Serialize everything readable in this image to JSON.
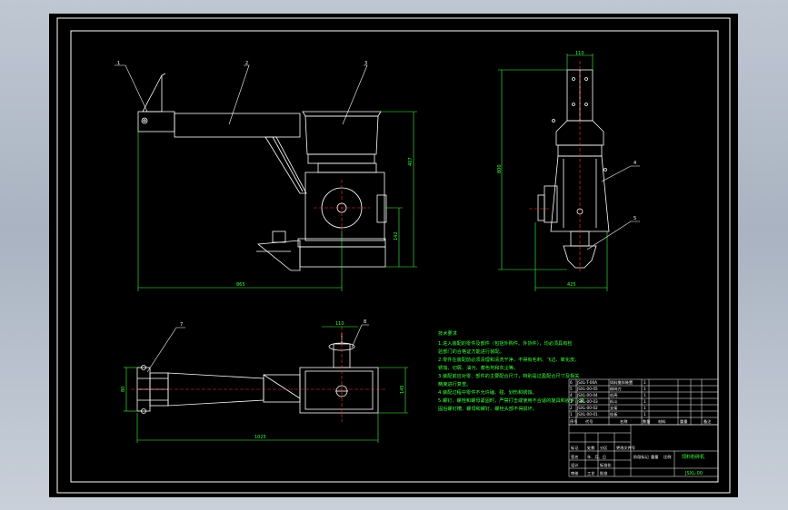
{
  "balloons": [
    "1",
    "2",
    "3",
    "4",
    "5",
    "6",
    "7",
    "8"
  ],
  "dimensions": {
    "front_overall_width": "865",
    "front_height_a": "407",
    "front_height_b": "142",
    "side_height": "800",
    "side_top_width": "110",
    "side_base_width": "425",
    "top_width": "1025",
    "top_left_h": "80",
    "top_right_h": "145",
    "top_small": "110"
  },
  "notes": {
    "heading": "技术要求",
    "lines": [
      "1.进入装配的零件及部件（包括外购件、外协件），均必须具有检",
      "验部门的合格证方能进行装配。",
      "2.零件在装配前必须清理和清洗干净，不得有毛刺、飞边、氧化皮、",
      "锈蚀、切屑、油污、着色剂和灰尘等。",
      "3.装配前应对零、部件的主要配合尺寸，特别是过盈配合尺寸及相关",
      "精度进行复查。",
      "4.装配过程中零件不允许磕、碰、划伤和锈蚀。",
      "5.螺钉、螺栓和螺母紧固时，严禁打击或使用不合适的旋具和扳手。紧",
      "固后螺钉槽、螺母和螺钉、螺栓头部不得损坏。"
    ]
  },
  "title_block": {
    "parts": [
      {
        "no": "6",
        "code": "JSXL-T-00A",
        "name": "饲料搅拌装置",
        "qty": "1",
        "mat": ""
      },
      {
        "no": "5",
        "code": "JSXL-00-05",
        "name": "粉碎刀",
        "qty": "1",
        "mat": ""
      },
      {
        "no": "4",
        "code": "JSXL-00-04",
        "name": "机壳",
        "qty": "1",
        "mat": ""
      },
      {
        "no": "3",
        "code": "JSXL-00-03",
        "name": "料斗",
        "qty": "1",
        "mat": ""
      },
      {
        "no": "2",
        "code": "JSXL-00-02",
        "name": "支架",
        "qty": "1",
        "mat": ""
      },
      {
        "no": "1",
        "code": "JSXL-00-01",
        "name": "挂板",
        "qty": "1",
        "mat": ""
      }
    ],
    "header": {
      "no": "序号",
      "code": "代号",
      "name": "名称",
      "qty": "数量",
      "mat": "材料",
      "weight": "重量",
      "remark": "备注"
    },
    "title": "饲料粉碎机",
    "drawing_no": "JSXL-00",
    "labels": [
      "标记",
      "处数",
      "分区",
      "更改文件号",
      "签名",
      "年、月、日",
      "设计",
      "标准化",
      "审核",
      "工艺",
      "批准",
      "阶段标记",
      "重量",
      "比例"
    ]
  },
  "colors": {
    "line": "#ffffff",
    "dim": "#3cff3c",
    "balloon": "#ffffff",
    "center": "#ff3030",
    "paper": "#000000"
  }
}
